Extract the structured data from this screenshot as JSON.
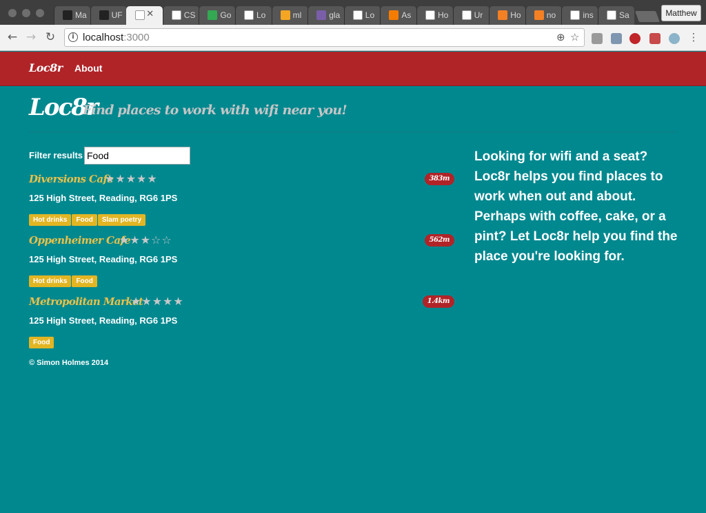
{
  "browser": {
    "tabs": [
      {
        "title": "Ma",
        "icon": "github-icon",
        "color": "#222222"
      },
      {
        "title": "UF",
        "icon": "github-icon",
        "color": "#222222"
      },
      {
        "title": "",
        "icon": "page-icon",
        "color": "#ffffff",
        "active": true
      },
      {
        "title": "CS",
        "icon": "page-icon",
        "color": "#ffffff"
      },
      {
        "title": "Go",
        "icon": "maps-icon",
        "color": "#34a853"
      },
      {
        "title": "Lo",
        "icon": "page-icon",
        "color": "#ffffff"
      },
      {
        "title": "ml",
        "icon": "ml-icon",
        "color": "#f4a623"
      },
      {
        "title": "gla",
        "icon": "k-icon",
        "color": "#7a5ea8"
      },
      {
        "title": "Lo",
        "icon": "page-icon",
        "color": "#ffffff"
      },
      {
        "title": "As",
        "icon": "analytics-icon",
        "color": "#f57c00"
      },
      {
        "title": "Ho",
        "icon": "page-icon",
        "color": "#ffffff"
      },
      {
        "title": "Ur",
        "icon": "mountain-icon",
        "color": "#ffffff"
      },
      {
        "title": "Ho",
        "icon": "stackoverflow-icon",
        "color": "#f48024"
      },
      {
        "title": "no",
        "icon": "stackoverflow-icon",
        "color": "#f48024"
      },
      {
        "title": "ins",
        "icon": "google-icon",
        "color": "#ffffff"
      },
      {
        "title": "Sa",
        "icon": "page-icon",
        "color": "#ffffff"
      }
    ],
    "profile_name": "Matthew",
    "url_host": "localhost",
    "url_port": ":3000"
  },
  "navbar": {
    "brand": "Loc8r",
    "about": "About"
  },
  "header": {
    "brand": "Loc8r",
    "tagline": "Find places to work with wifi near you!"
  },
  "filter": {
    "label": "Filter results",
    "value": "Food"
  },
  "locations": [
    {
      "name": "Diversions Cafe",
      "rating": 0,
      "stars": "★★★★★",
      "distance": "383m",
      "address": "125 High Street, Reading, RG6 1PS",
      "facilities": [
        "Hot drinks",
        "Food",
        "Slam poetry"
      ]
    },
    {
      "name": "Oppenheimer Cafe",
      "rating": 3,
      "stars": "★★★☆☆",
      "distance": "562m",
      "address": "125 High Street, Reading, RG6 1PS",
      "facilities": [
        "Hot drinks",
        "Food"
      ]
    },
    {
      "name": "Metropolitan Market",
      "rating": 0,
      "stars": "★★★★★",
      "distance": "1.4km",
      "address": "125 High Street, Reading, RG6 1PS",
      "facilities": [
        "Food"
      ]
    }
  ],
  "footer": "© Simon Holmes 2014",
  "sidebar": "Looking for wifi and a seat? Loc8r helps you find places to work when out and about. Perhaps with coffee, cake, or a pint? Let Loc8r help you find the place you're looking for.",
  "colors": {
    "page_bg": "#00888f",
    "navbar_bg": "#b02428",
    "location_name": "#e9c14a",
    "facility_badge": "#e2b523",
    "star_empty": "#c8c8c8"
  }
}
